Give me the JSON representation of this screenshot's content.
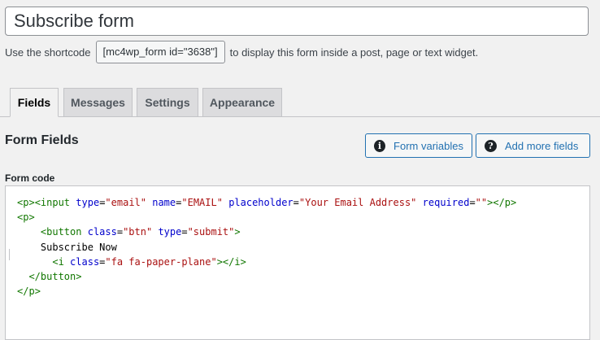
{
  "form": {
    "title": "Subscribe form",
    "shortcode_prefix": "Use the shortcode",
    "shortcode": "[mc4wp_form id=\"3638\"]",
    "shortcode_suffix": "to display this form inside a post, page or text widget."
  },
  "tabs": [
    {
      "label": "Fields",
      "active": true
    },
    {
      "label": "Messages",
      "active": false
    },
    {
      "label": "Settings",
      "active": false
    },
    {
      "label": "Appearance",
      "active": false
    }
  ],
  "section": {
    "title": "Form Fields",
    "form_variables_label": "Form variables",
    "form_variables_icon": "info-icon",
    "add_fields_label": "Add more fields",
    "add_fields_icon": "question-icon"
  },
  "code": {
    "label": "Form code",
    "lines": [
      "<p><input type=\"email\" name=\"EMAIL\" placeholder=\"Your Email Address\" required=\"\"></p>",
      "<p>",
      "    <button class=\"btn\" type=\"submit\">",
      "    Subscribe Now",
      "      <i class=\"fa fa-paper-plane\"></i>",
      "  </button>",
      "</p>"
    ]
  },
  "colors": {
    "accent": "#2271b1",
    "code_tag": "#117700",
    "code_attr": "#0000cc",
    "code_string": "#aa1111"
  }
}
